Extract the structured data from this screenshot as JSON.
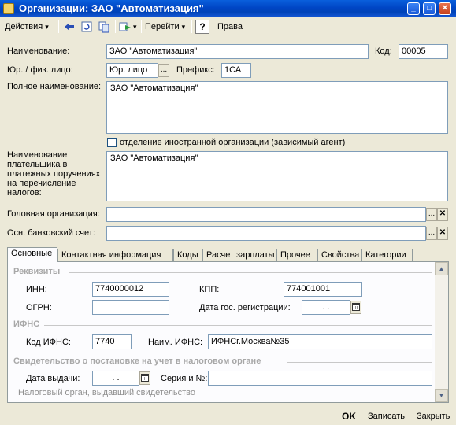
{
  "window": {
    "title": "Организации: ЗАО \"Автоматизация\"",
    "min_label": "_",
    "max_label": "□",
    "close_label": "✕"
  },
  "toolbar": {
    "actions_label": "Действия",
    "goto_label": "Перейти",
    "help_label": "?",
    "rights_label": "Права"
  },
  "form": {
    "name_label": "Наименование:",
    "name_value": "ЗАО \"Автоматизация\"",
    "code_label": "Код:",
    "code_value": "00005",
    "entity_label": "Юр. / физ. лицо:",
    "entity_value": "Юр. лицо",
    "prefix_label": "Префикс:",
    "prefix_value": "1СА",
    "fullname_label": "Полное наименование:",
    "fullname_value": "ЗАО \"Автоматизация\"",
    "foreign_label": "отделение иностранной организации (зависимый агент)",
    "payer_label": "Наименование плательщика в платежных поручениях на перечисление налогов:",
    "payer_value": "ЗАО \"Автоматизация\"",
    "head_org_label": "Головная организация:",
    "head_org_value": "",
    "bank_label": "Осн. банковский счет:",
    "bank_value": "",
    "ellipsis": "...",
    "clear": "✕"
  },
  "tabs": [
    {
      "label": "Основные"
    },
    {
      "label": "Контактная информация"
    },
    {
      "label": "Коды"
    },
    {
      "label": "Расчет зарплаты"
    },
    {
      "label": "Прочее"
    },
    {
      "label": "Свойства"
    },
    {
      "label": "Категории"
    }
  ],
  "main_tab": {
    "requisites_title": "Реквизиты",
    "inn_label": "ИНН:",
    "inn_value": "7740000012",
    "kpp_label": "КПП:",
    "kpp_value": "774001001",
    "ogrn_label": "ОГРН:",
    "ogrn_value": "",
    "reg_date_label": "Дата гос. регистрации:",
    "reg_date_value": ". .",
    "ifns_title": "ИФНС",
    "ifns_code_label": "Код ИФНС:",
    "ifns_code_value": "7740",
    "ifns_name_label": "Наим. ИФНС:",
    "ifns_name_value": "ИФНСг.Москва№35",
    "cert_title": "Свидетельство о постановке на учет в налоговом органе",
    "issue_date_label": "Дата выдачи:",
    "issue_date_value": ". .",
    "series_label": "Серия и №:",
    "series_value": "",
    "tax_authority_label": "Налоговый орган, выдавший свидетельство"
  },
  "bottom": {
    "ok_label": "OK",
    "save_label": "Записать",
    "close_label": "Закрыть"
  }
}
